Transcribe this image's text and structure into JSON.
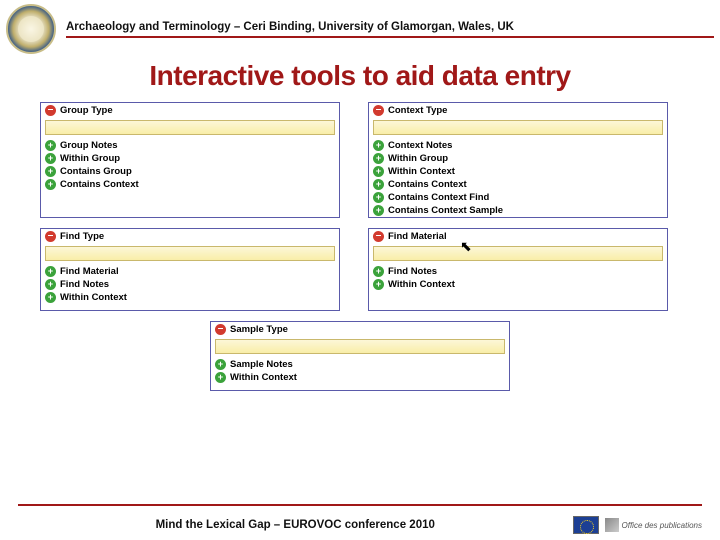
{
  "header": {
    "subtitle": "Archaeology and Terminology – Ceri Binding, University of Glamorgan, Wales, UK",
    "title": "Interactive tools to aid data entry"
  },
  "panels": {
    "group": {
      "header": "Group Type",
      "items": [
        "Group Notes",
        "Within Group",
        "Contains Group",
        "Contains Context"
      ]
    },
    "context": {
      "header": "Context Type",
      "items": [
        "Context Notes",
        "Within Group",
        "Within Context",
        "Contains Context",
        "Contains Context Find",
        "Contains Context Sample"
      ]
    },
    "find": {
      "header": "Find Type",
      "items": [
        "Find Material",
        "Find Notes",
        "Within Context"
      ]
    },
    "findmat": {
      "header": "Find Material",
      "items": [
        "Find Notes",
        "Within Context"
      ]
    },
    "sample": {
      "header": "Sample Type",
      "items": [
        "Sample Notes",
        "Within Context"
      ]
    }
  },
  "footer": {
    "text": "Mind the Lexical Gap – EUROVOC conference 2010",
    "publisher": "Office des publications"
  }
}
